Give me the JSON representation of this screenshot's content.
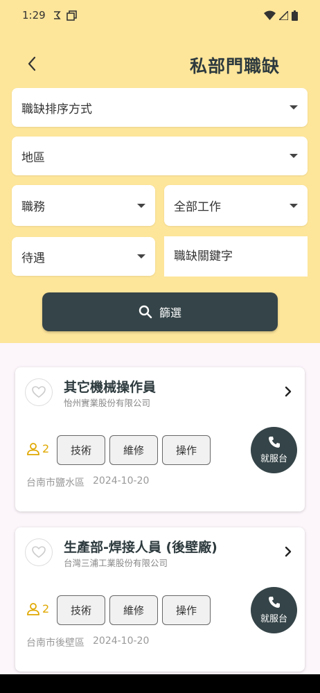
{
  "status_bar": {
    "time": "1:29"
  },
  "header": {
    "title": "私部門職缺"
  },
  "filters": {
    "sort": "職缺排序方式",
    "region": "地區",
    "position": "職務",
    "job_type": "全部工作",
    "benefits": "待遇",
    "keyword_placeholder": "職缺關鍵字",
    "filter_button": "篩選"
  },
  "jobs": [
    {
      "title": "其它機械操作員",
      "company": "怡州實業股份有限公司",
      "openings": "2",
      "tags": [
        "技術",
        "維修",
        "操作"
      ],
      "location": "台南市鹽水區",
      "date": "2024-10-20",
      "call_label": "就服台"
    },
    {
      "title": "生產部-焊接人員 (後壁廠)",
      "company": "台灣三浦工業股份有限公司",
      "openings": "2",
      "tags": [
        "技術",
        "維修",
        "操作"
      ],
      "location": "台南市後壁區",
      "date": "2024-10-20",
      "call_label": "就服台"
    }
  ],
  "colors": {
    "header_bg": "#fde59a",
    "dark_accent": "#354448",
    "openings_accent": "#e0a800"
  }
}
